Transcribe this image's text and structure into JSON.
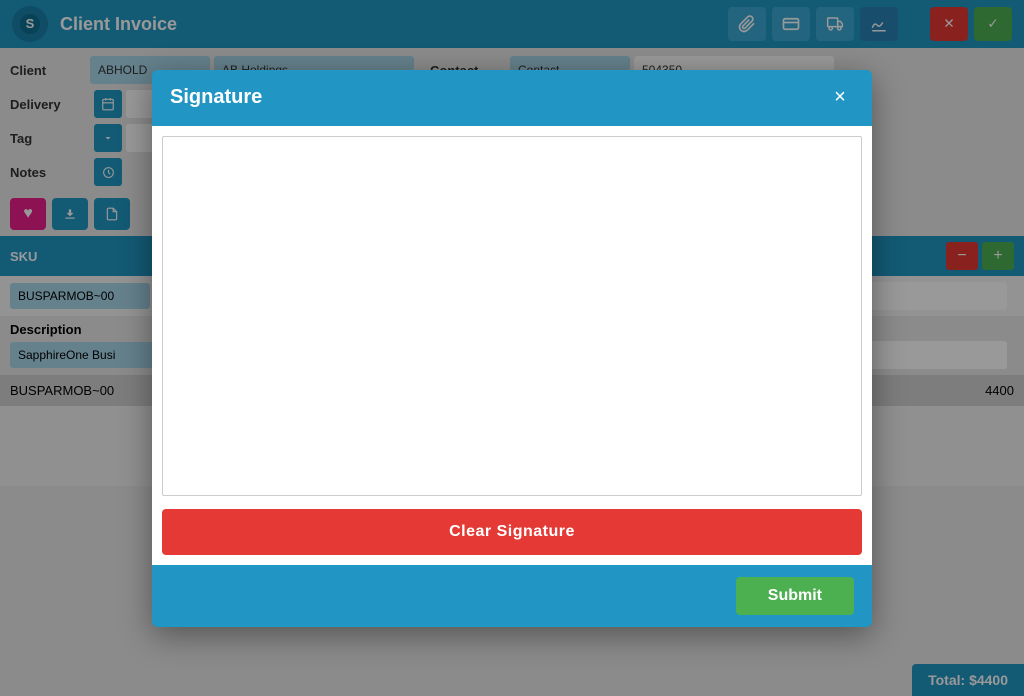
{
  "app": {
    "logo_icon": "S",
    "title": "Client Invoice"
  },
  "toolbar": {
    "attachment_label": "📎",
    "card_label": "💳",
    "truck_label": "🚚",
    "signature_label": "✍"
  },
  "header_actions": {
    "close_label": "✕",
    "check_label": "✓"
  },
  "form": {
    "client_label": "Client",
    "client_value": "ABHOLD",
    "client_name_value": "AB Holdings",
    "contact_label": "Contact",
    "contact_value": "504350",
    "delivery_label": "Delivery",
    "tag_label": "Tag",
    "notes_label": "Notes"
  },
  "action_buttons": {
    "heart_icon": "♥",
    "download_icon": "⬇",
    "doc_icon": "📄"
  },
  "sku_section": {
    "header_label": "SKU",
    "minus_label": "−",
    "plus_label": "+",
    "sku_value": "BUSPARMOB~00"
  },
  "description_section": {
    "label": "Description",
    "value": "SapphireOne Busi"
  },
  "item_row": {
    "sku": "BUSPARMOB~00",
    "amount": "4400"
  },
  "total": {
    "label": "Total: $4400"
  },
  "modal": {
    "title": "Signature",
    "close_icon": "×",
    "clear_button_label": "Clear Signature",
    "submit_button_label": "Submit"
  }
}
